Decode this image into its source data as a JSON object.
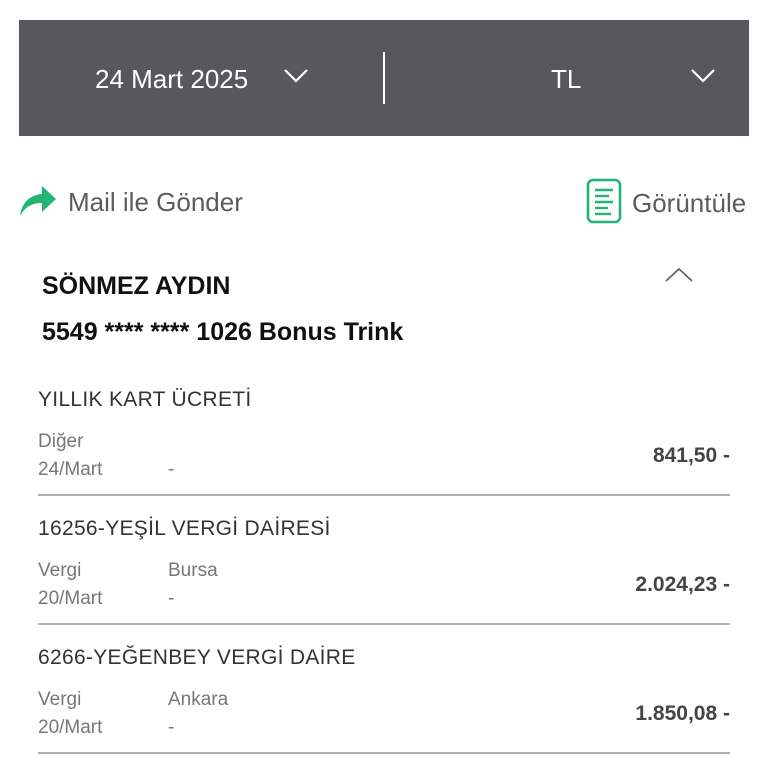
{
  "filter_bar": {
    "date_label": "24 Mart 2025",
    "currency_label": "TL",
    "bar_color": "#58575c",
    "date_chevron_icon": "chevron-down-icon",
    "currency_chevron_icon": "chevron-down-icon"
  },
  "actions": {
    "mail_label": "Mail ile Gönder",
    "mail_icon": "share-arrow-icon",
    "view_label": "Görüntüle",
    "view_icon": "document-icon",
    "accent_color": "#22b573"
  },
  "card": {
    "holder_name": "SÖNMEZ AYDIN",
    "card_number": "5549 **** **** 1026 Bonus Trink",
    "collapse_icon": "chevron-up-icon"
  },
  "transactions": [
    {
      "title": "YILLIK KART ÜCRETİ",
      "type": "Diğer",
      "city": "",
      "date": "24/Mart",
      "dash": "-",
      "amount": "841,50 -"
    },
    {
      "title": "16256-YEŞİL VERGİ DAİRESİ",
      "type": "Vergi",
      "city": "Bursa",
      "date": "20/Mart",
      "dash": "-",
      "amount": "2.024,23 -"
    },
    {
      "title": "6266-YEĞENBEY VERGİ DAİRE",
      "type": "Vergi",
      "city": "Ankara",
      "date": "20/Mart",
      "dash": "-",
      "amount": "1.850,08 -"
    }
  ]
}
